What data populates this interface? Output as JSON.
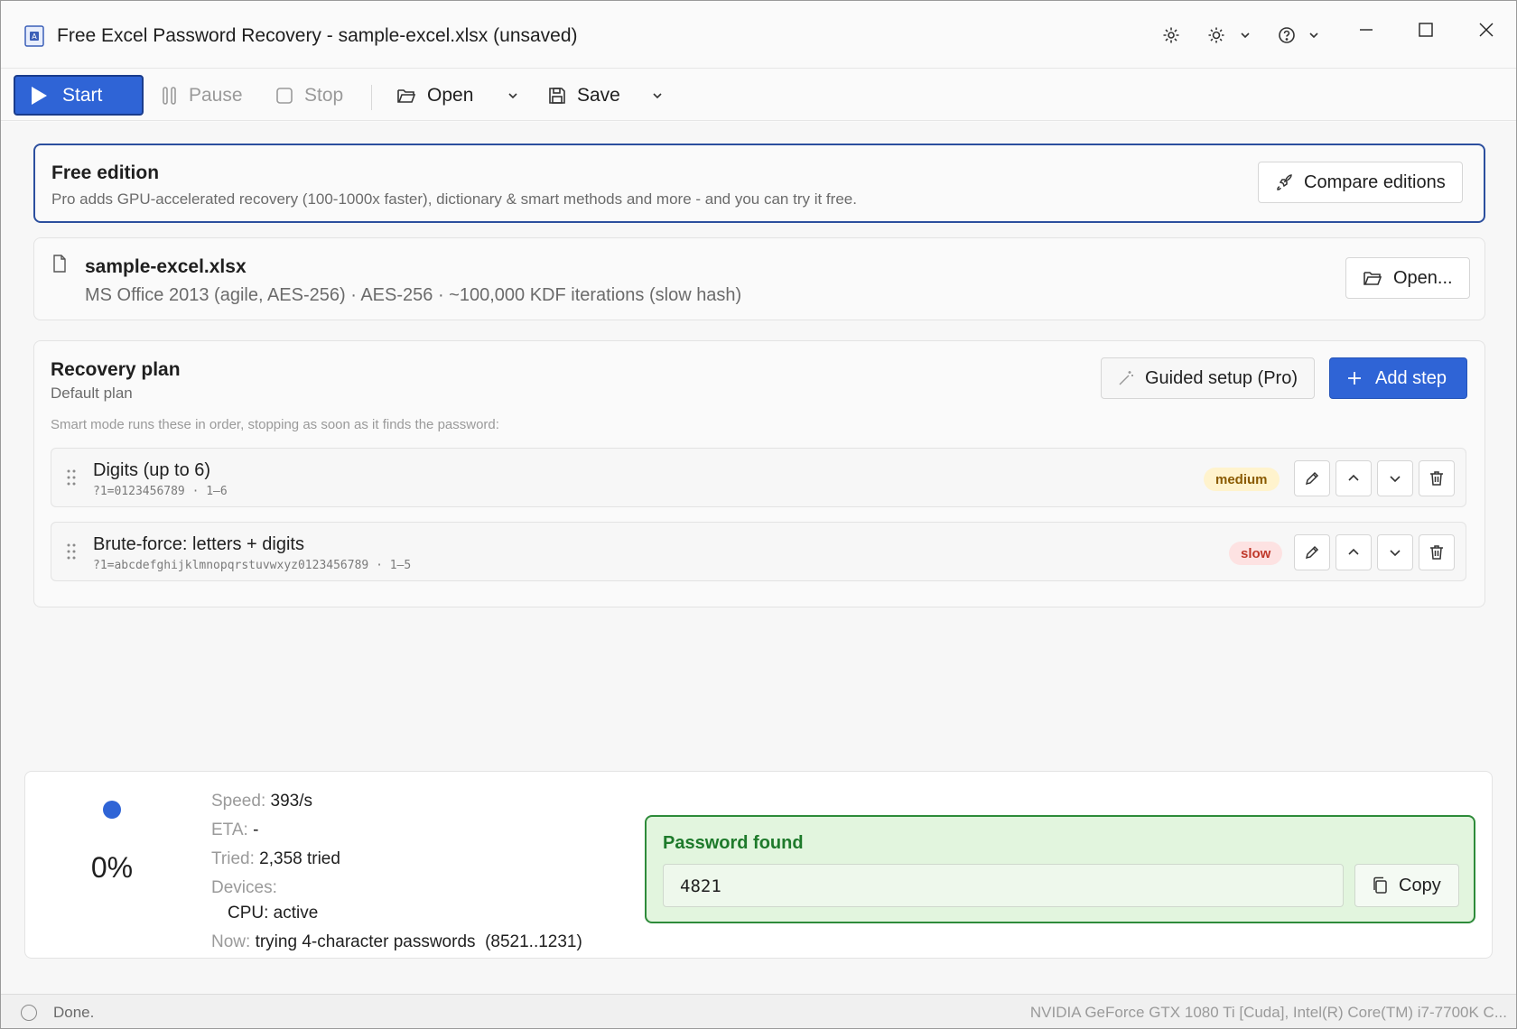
{
  "window": {
    "title": "Free Excel Password Recovery - sample-excel.xlsx (unsaved)",
    "icons": [
      "app-icon",
      "settings-icon",
      "theme-icon",
      "help-icon",
      "minimize-icon",
      "maximize-icon",
      "close-icon"
    ]
  },
  "toolbar": {
    "start_label": "Start",
    "pause_label": "Pause",
    "stop_label": "Stop",
    "open_label": "Open",
    "save_label": "Save"
  },
  "free_banner": {
    "title": "Free edition",
    "subtitle": "Pro adds GPU-accelerated recovery (100-1000x faster), dictionary & smart methods and more - and you can try it free.",
    "compare_label": "Compare editions"
  },
  "file": {
    "name": "sample-excel.xlsx",
    "meta": "MS Office 2013 (agile, AES-256) · AES-256 · ~100,000 KDF iterations (slow hash)",
    "open_label": "Open..."
  },
  "plan": {
    "title": "Recovery plan",
    "subtitle": "Default plan",
    "hint": "Smart mode runs these in order, stopping as soon as it finds the password:",
    "guided_label": "Guided setup (Pro)",
    "add_step_label": "Add step",
    "steps": [
      {
        "title": "Digits (up to 6)",
        "mask": "?1=0123456789 · 1–6",
        "speed": "medium"
      },
      {
        "title": "Brute-force: letters + digits",
        "mask": "?1=abcdefghijklmnopqrstuvwxyz0123456789 · 1–5",
        "speed": "slow"
      }
    ]
  },
  "progress": {
    "percent_text": "0%",
    "speed_label": "Speed:",
    "speed_value": "393/s",
    "eta_label": "ETA:",
    "eta_value": "-",
    "tried_label": "Tried:",
    "tried_value": "2,358 tried",
    "devices_label": "Devices:",
    "device_line": "CPU: active",
    "now_label": "Now:",
    "now_value": "trying 4-character passwords  (8521..1231)"
  },
  "found": {
    "title": "Password found",
    "password": "4821",
    "copy_label": "Copy"
  },
  "status": {
    "text": "Done.",
    "devices": "NVIDIA GeForce GTX 1080 Ti [Cuda], Intel(R) Core(TM) i7-7700K C..."
  },
  "colors": {
    "accent": "#2f64d6",
    "success": "#2e8b3a",
    "success_bg": "#e2f5de",
    "medium_badge": "#fff3cd",
    "slow_badge": "#fde2e2"
  }
}
